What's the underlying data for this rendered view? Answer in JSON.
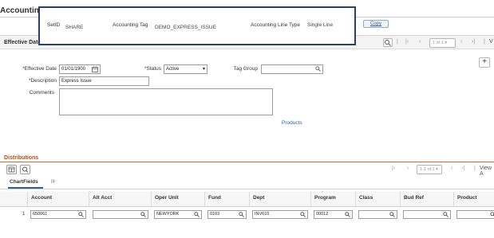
{
  "page_title": "Accounting Tags",
  "overlay": {
    "setid_label": "SetID",
    "setid_value": "SHARE",
    "tag_label": "Accounting Tag",
    "tag_value": "DEMO_EXPRESS_ISSUE",
    "line_type_label": "Accounting Line Type",
    "line_type_value": "Single Line"
  },
  "copy_button": "Copy",
  "effective_section": {
    "title": "Effective Date",
    "pager": "1 of 1",
    "view_all": "V"
  },
  "form": {
    "effdt_label": "*Effective Date",
    "effdt_value": "01/01/1900",
    "status_label": "*Status",
    "status_value": "Active",
    "group_label": "Tag Group",
    "group_value": "",
    "description_label": "*Description",
    "description_value": "Express Issue",
    "comments_label": "Comments",
    "comments_value": "",
    "products_link": "Products",
    "add_row": "+"
  },
  "distributions": {
    "title": "Distributions",
    "pager": "1-1 of 1",
    "view_all": "View A",
    "tab_label": "ChartFields",
    "columns": [
      "Account",
      "Alt Acct",
      "Oper Unit",
      "Fund",
      "Dept",
      "Program",
      "Class",
      "Bud Ref",
      "Product"
    ],
    "row": {
      "num": "1",
      "account": "650061",
      "alt_acct": "",
      "oper_unit": "NEWYORK",
      "fund": "0103",
      "dept": "INV610",
      "program": "00012",
      "class": "",
      "bud_ref": "",
      "product": ""
    }
  }
}
